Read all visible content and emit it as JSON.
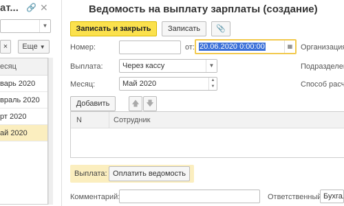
{
  "left": {
    "title_partial": "ат...",
    "link_icon": "link-icon",
    "close_icon": "close-icon",
    "clear_label": "×",
    "more_label": "Еще",
    "column_header": "есяц",
    "rows": [
      "варь 2020",
      "враль 2020",
      "рт 2020",
      "ай 2020"
    ]
  },
  "form": {
    "title": "Ведомость на выплату зарплаты (создание)",
    "save_close_label": "Записать и закрыть",
    "save_label": "Записать",
    "attach_icon": "paperclip-icon",
    "number_label": "Номер:",
    "number_value": "",
    "from_label": "от:",
    "date_value": "20.06.2020  0:00:00",
    "org_label": "Организация:",
    "payout_label": "Выплата:",
    "payout_value": "Через кассу",
    "subdivision_label": "Подразделен",
    "month_label": "Месяц:",
    "month_value": "Май 2020",
    "method_label": "Способ расче",
    "add_label": "Добавить",
    "table": {
      "col_n": "N",
      "col_employee": "Сотрудник"
    },
    "pay_label": "Выплата:",
    "pay_button_label": "Оплатить ведомость",
    "comment_label": "Комментарий:",
    "comment_value": "",
    "responsible_label": "Ответственный:",
    "responsible_value": "Бухгал"
  }
}
